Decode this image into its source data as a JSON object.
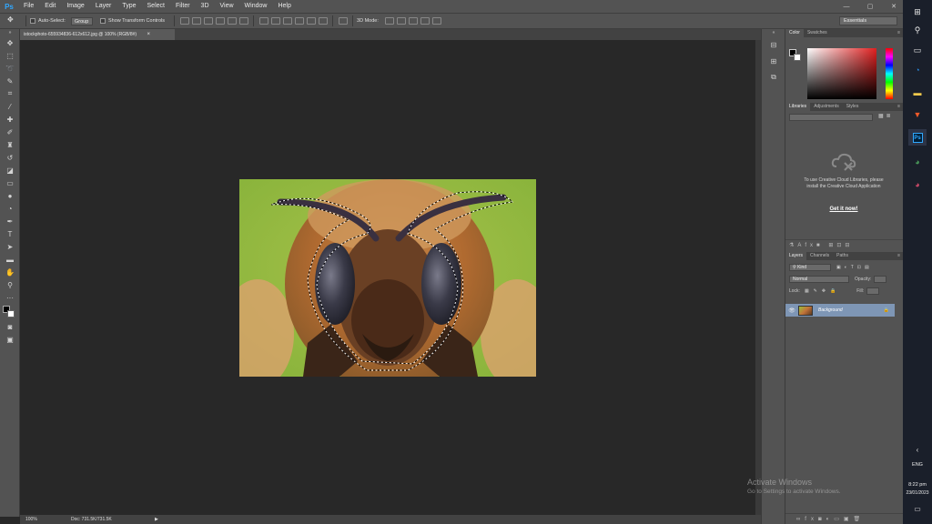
{
  "app": {
    "logo": "Ps",
    "menus": [
      "File",
      "Edit",
      "Image",
      "Layer",
      "Type",
      "Select",
      "Filter",
      "3D",
      "View",
      "Window",
      "Help"
    ],
    "window_controls": [
      "—",
      "▢",
      "✕"
    ]
  },
  "options": {
    "auto_select_label": "Auto-Select:",
    "auto_select_value": "Group",
    "transform_label": "Show Transform Controls",
    "mode_3d_label": "3D Mode:",
    "workspace": "Essentials"
  },
  "document": {
    "tab_title": "istockphoto-655934836-612x612.jpg @ 100% (RGB/8#)",
    "close": "×",
    "zoom": "100%",
    "doc_info": "Doc: 731.5K/731.5K",
    "status_arrow": "▶"
  },
  "color_panel": {
    "tabs": [
      "Color",
      "Swatches"
    ],
    "foreground": "#000000",
    "background": "#ffffff"
  },
  "libraries_panel": {
    "tabs": [
      "Libraries",
      "Adjustments",
      "Styles"
    ],
    "message": "To use Creative Cloud Libraries, please install the Creative Cloud Application",
    "link": "Get it now!"
  },
  "layers_panel": {
    "tabs": [
      "Layers",
      "Channels",
      "Paths"
    ],
    "filter_kind": "Kind",
    "blend_mode": "Normal",
    "opacity_label": "Opacity:",
    "lock_label": "Lock:",
    "fill_label": "Fill:",
    "layers": [
      {
        "name": "Background",
        "visible": true,
        "locked": true
      }
    ]
  },
  "watermark": {
    "title": "Activate Windows",
    "subtitle": "Go to Settings to activate Windows."
  },
  "taskbar": {
    "language": "ENG",
    "time": "8:22 pm",
    "date": "23/01/2023"
  },
  "icons": {
    "tools": [
      "move-icon",
      "marquee-icon",
      "lasso-icon",
      "quick-select-icon",
      "crop-icon",
      "eyedropper-icon",
      "healing-icon",
      "brush-icon",
      "stamp-icon",
      "history-brush-icon",
      "eraser-icon",
      "gradient-icon",
      "blur-icon",
      "dodge-icon",
      "pen-icon",
      "type-icon",
      "path-select-icon",
      "rectangle-icon",
      "hand-icon",
      "zoom-icon"
    ]
  }
}
